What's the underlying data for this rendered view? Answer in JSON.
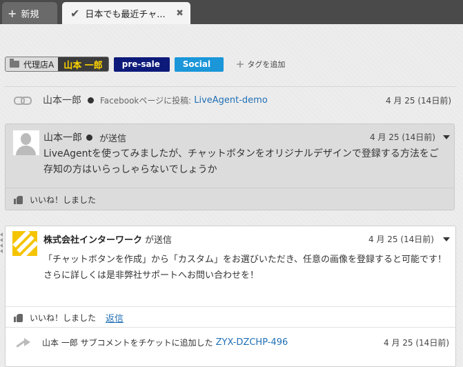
{
  "tabs": {
    "new_label": "新規",
    "active_label": "日本でも最近チャ..."
  },
  "tags": {
    "agency": "代理店A",
    "person": "山本 一郎",
    "presale": "pre-sale",
    "social": "Social",
    "add_tag": "タグを追加"
  },
  "event": {
    "author": "山本一郎",
    "action": "Facebookページに投稿:",
    "target": "LiveAgent-demo",
    "date": "4 月 25 (14日前)"
  },
  "message1": {
    "author": "山本一郎",
    "sent": "が送信",
    "date": "4 月 25 (14日前)",
    "body": "LiveAgentを使ってみましたが、チャットボタンをオリジナルデザインで登録する方法をご存知の方はいらっしゃらないでしょうか",
    "like": "いいね！しました"
  },
  "message2": {
    "author": "株式会社インターワーク",
    "sent": "が送信",
    "date": "4 月 25 (14日前)",
    "body": "「チャットボタンを作成」から「カスタム」をお選びいただき、任意の画像を登録すると可能です！さらに詳しくは是非弊社サポートへお問い合わせを！",
    "like": "いいね！しました",
    "reply": "返信"
  },
  "subcomment": {
    "text": "山本 一郎 サブコメントをチケットに追加した",
    "ticket": "ZYX-DZCHP-496",
    "date": "4 月 25 (14日前)"
  },
  "colors": {
    "presale_tag": "#0d1a7a",
    "social_tag": "#1a96d9",
    "link": "#1f6fb5",
    "logo": "#f5c400"
  }
}
